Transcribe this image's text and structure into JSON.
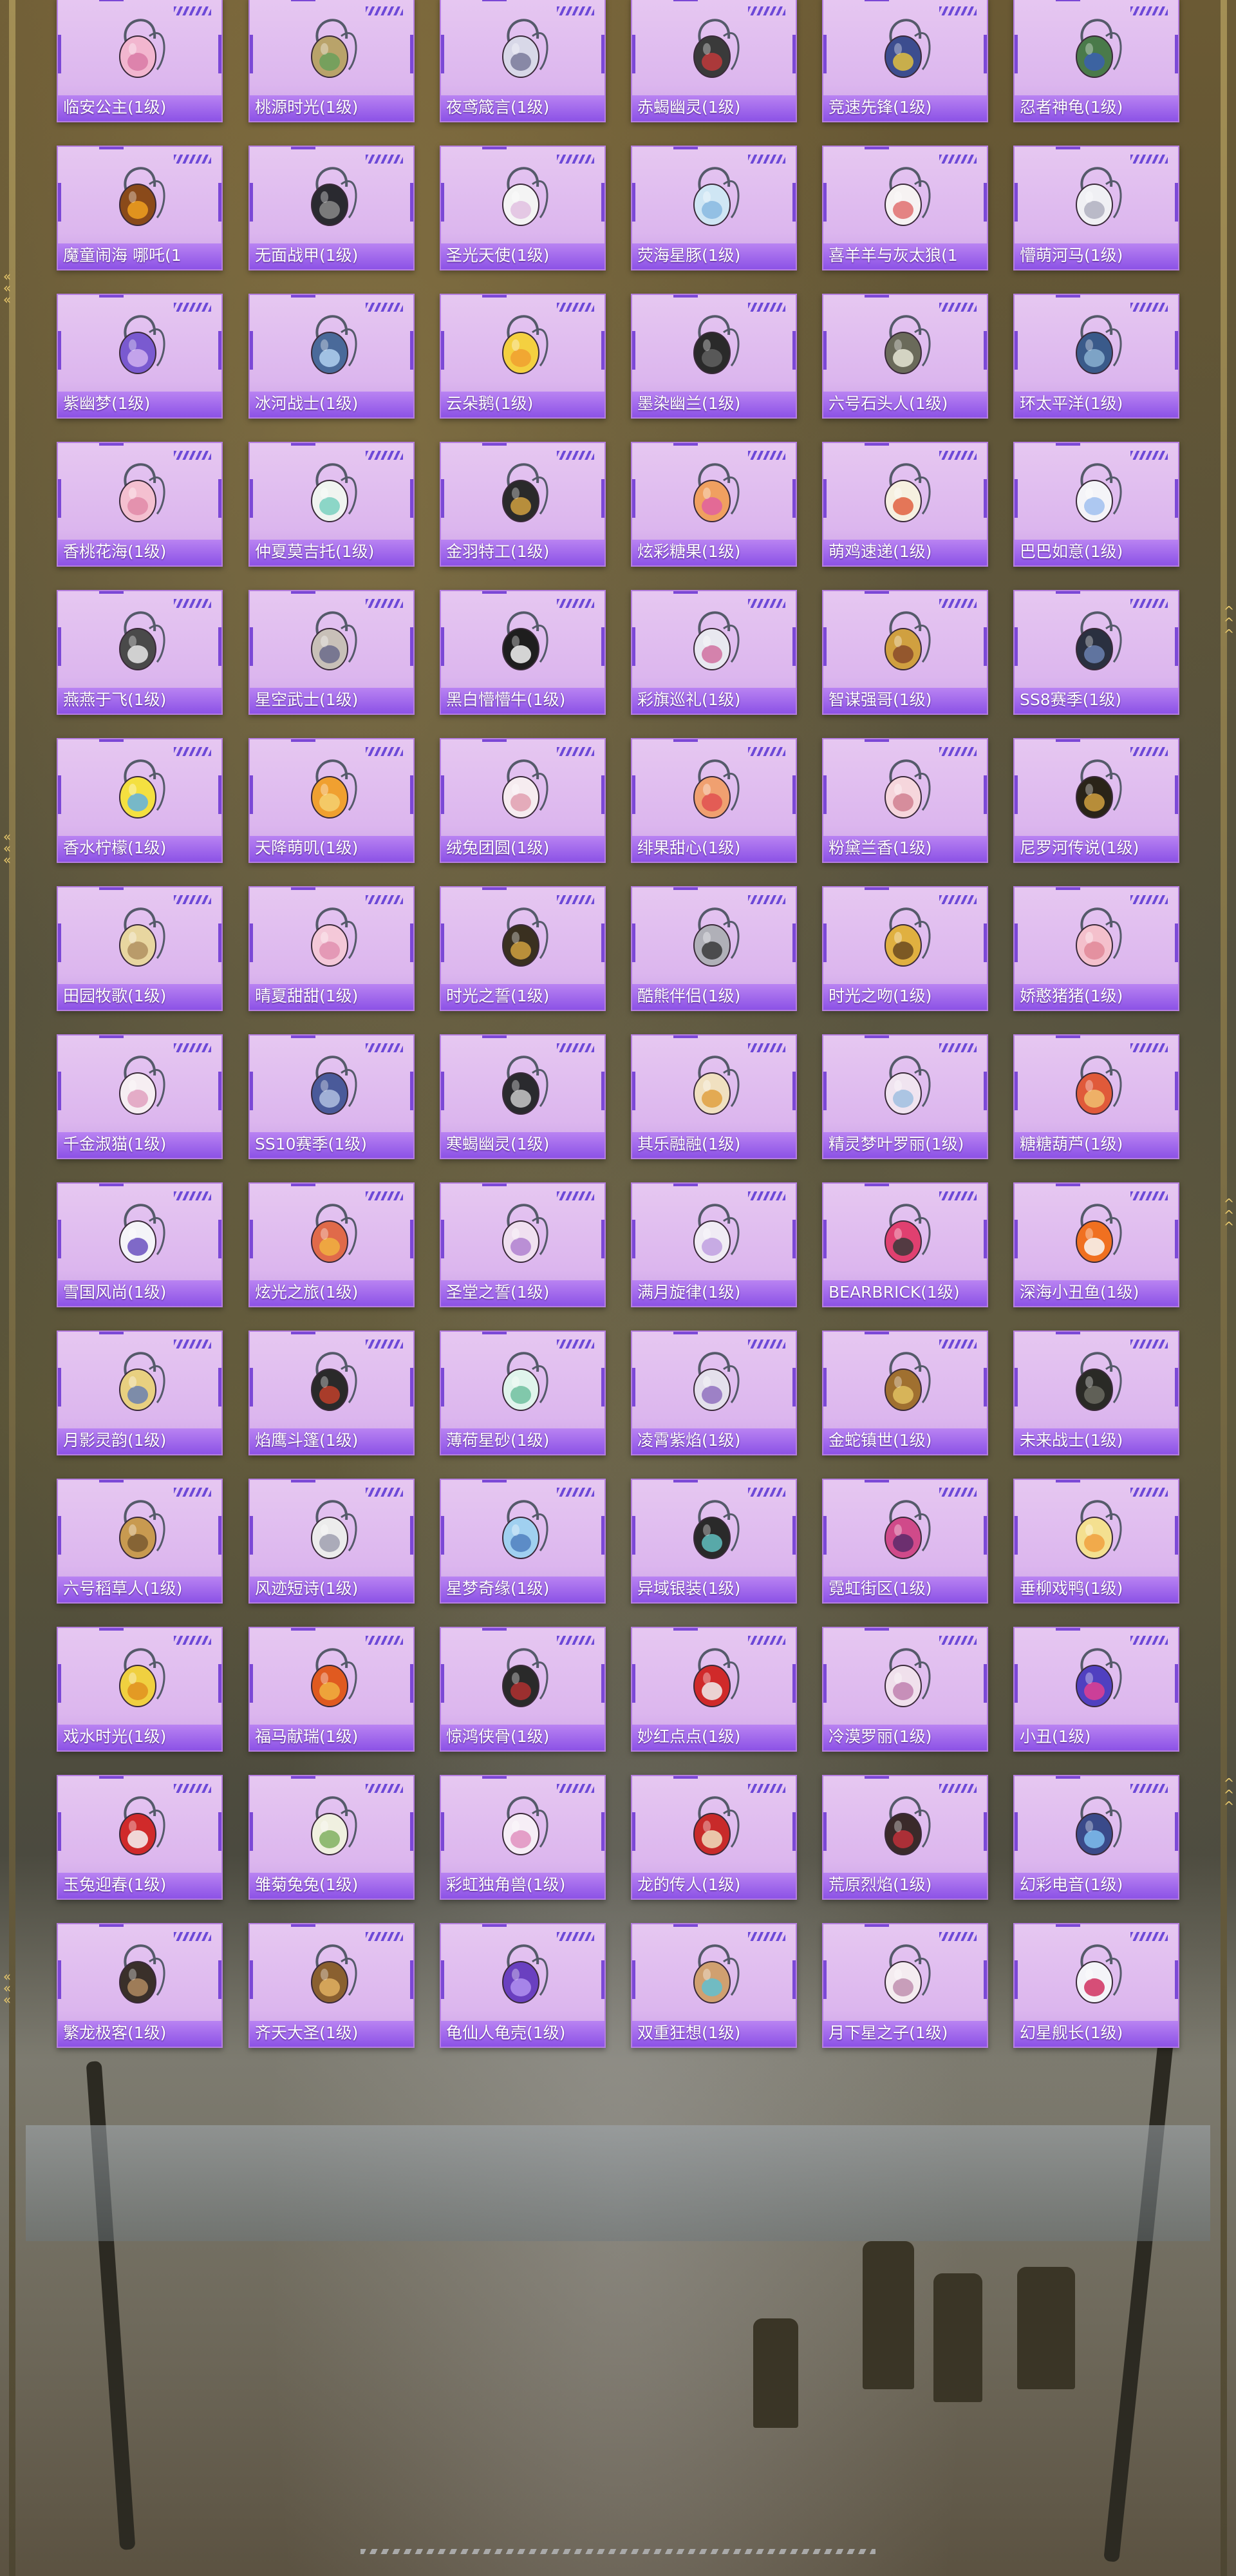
{
  "grid": {
    "level_suffix": "(1级)",
    "items": [
      {
        "name": "临安公主(1级)",
        "color": "#f2b6cf",
        "accent": "#d97aa6",
        "icon": "bag-pink-flower-icon"
      },
      {
        "name": "桃源时光(1级)",
        "color": "#b9a36a",
        "accent": "#6aa05a",
        "icon": "bag-basket-icon"
      },
      {
        "name": "夜鸢箴言(1级)",
        "color": "#d8d8e8",
        "accent": "#7a7a9a",
        "icon": "bag-doll-icon"
      },
      {
        "name": "赤蝎幽灵(1级)",
        "color": "#3a3a3a",
        "accent": "#c0393b",
        "icon": "bag-black-backpack-icon"
      },
      {
        "name": "竞速先锋(1级)",
        "color": "#3c4d8f",
        "accent": "#e0c040",
        "icon": "bag-racer-icon"
      },
      {
        "name": "忍者神龟(1级)",
        "color": "#4a7a4a",
        "accent": "#3a5fb0",
        "icon": "bag-turtle-icon"
      },
      {
        "name": "魔童闹海 哪吒(1",
        "color": "#8a4a1a",
        "accent": "#f0a020",
        "icon": "bag-round-medal-icon"
      },
      {
        "name": "无面战甲(1级)",
        "color": "#2a2a30",
        "accent": "#888888",
        "icon": "bag-armor-icon"
      },
      {
        "name": "圣光天使(1级)",
        "color": "#f4f4f4",
        "accent": "#e0c0e0",
        "icon": "bag-angel-icon"
      },
      {
        "name": "荧海星豚(1级)",
        "color": "#cfe6f4",
        "accent": "#88b8e0",
        "icon": "bag-dolphin-icon"
      },
      {
        "name": "喜羊羊与灰太狼(1",
        "color": "#f6f2f2",
        "accent": "#e07070",
        "icon": "bag-sheep-icon"
      },
      {
        "name": "懵萌河马(1级)",
        "color": "#f0f0f4",
        "accent": "#b0b0c0",
        "icon": "bag-hippo-icon"
      },
      {
        "name": "紫幽梦(1级)",
        "color": "#7a5ad0",
        "accent": "#d0b0f0",
        "icon": "bag-purple-orb-icon"
      },
      {
        "name": "冰河战士(1级)",
        "color": "#4a6a9a",
        "accent": "#b0d0f0",
        "icon": "bag-ice-warrior-icon"
      },
      {
        "name": "云朵鹅(1级)",
        "color": "#f4d040",
        "accent": "#f0a030",
        "icon": "bag-cloud-goose-icon"
      },
      {
        "name": "墨染幽兰(1级)",
        "color": "#2a2a2a",
        "accent": "#606060",
        "icon": "bag-ink-orchid-icon"
      },
      {
        "name": "六号石头人(1级)",
        "color": "#6a6a5a",
        "accent": "#e6e6d6",
        "icon": "bag-stone-man-icon"
      },
      {
        "name": "环太平洋(1级)",
        "color": "#3a5a8a",
        "accent": "#8ab0d0",
        "icon": "bag-mech-icon"
      },
      {
        "name": "香桃花海(1级)",
        "color": "#f4c0d0",
        "accent": "#e08aa8",
        "icon": "bag-peach-icon"
      },
      {
        "name": "仲夏莫吉托(1级)",
        "color": "#f0f4f0",
        "accent": "#7ad0c0",
        "icon": "bag-mojito-icon"
      },
      {
        "name": "金羽特工(1级)",
        "color": "#2a2a2a",
        "accent": "#d0a040",
        "icon": "bag-golden-agent-icon"
      },
      {
        "name": "炫彩糖果(1级)",
        "color": "#f0a060",
        "accent": "#e060a0",
        "icon": "bag-candy-icon"
      },
      {
        "name": "萌鸡速递(1级)",
        "color": "#f6f0e0",
        "accent": "#e06040",
        "icon": "bag-chick-icon"
      },
      {
        "name": "巴巴如意(1级)",
        "color": "#f4f4f8",
        "accent": "#a0c0f0",
        "icon": "bag-bunny-white-icon"
      },
      {
        "name": "燕燕于飞(1级)",
        "color": "#4a4a4a",
        "accent": "#e8e8e8",
        "icon": "bag-swallow-icon"
      },
      {
        "name": "星空武士(1级)",
        "color": "#c8c0b8",
        "accent": "#6a6a8a",
        "icon": "bag-star-warrior-icon"
      },
      {
        "name": "黑白懵懵牛(1级)",
        "color": "#1e1e1e",
        "accent": "#f4f4f4",
        "icon": "bag-cow-icon"
      },
      {
        "name": "彩旗巡礼(1级)",
        "color": "#e8e8f0",
        "accent": "#d070a0",
        "icon": "bag-flag-icon"
      },
      {
        "name": "智谋强哥(1级)",
        "color": "#d0a040",
        "accent": "#8a4a2a",
        "icon": "bag-bear-icon"
      },
      {
        "name": "SS8赛季(1级)",
        "color": "#2a3040",
        "accent": "#6a80b0",
        "icon": "bag-ss8-icon"
      },
      {
        "name": "香水柠檬(1级)",
        "color": "#f4e040",
        "accent": "#60b0e0",
        "icon": "bag-lemon-icon"
      },
      {
        "name": "天降萌叽(1级)",
        "color": "#f0a030",
        "accent": "#f4d070",
        "icon": "bag-bird-icon"
      },
      {
        "name": "绒兔团圆(1级)",
        "color": "#f6ecf0",
        "accent": "#e0a0b0",
        "icon": "bag-plush-bunny-icon"
      },
      {
        "name": "绯果甜心(1级)",
        "color": "#f0a070",
        "accent": "#e05050",
        "icon": "bag-fruit-icon"
      },
      {
        "name": "粉黛兰香(1级)",
        "color": "#f6d6dc",
        "accent": "#d08090",
        "icon": "bag-pink-orb-icon"
      },
      {
        "name": "尼罗河传说(1级)",
        "color": "#2a2418",
        "accent": "#d0a040",
        "icon": "bag-nile-icon"
      },
      {
        "name": "田园牧歌(1级)",
        "color": "#e8d6a0",
        "accent": "#b09060",
        "icon": "bag-wicker-icon"
      },
      {
        "name": "晴夏甜甜(1级)",
        "color": "#f4c8d8",
        "accent": "#e090b0",
        "icon": "bag-sweet-icon"
      },
      {
        "name": "时光之誓(1级)",
        "color": "#3a3020",
        "accent": "#d0a040",
        "icon": "bag-clock-icon"
      },
      {
        "name": "酷熊伴侣(1级)",
        "color": "#b0b0b8",
        "accent": "#3a3a3a",
        "icon": "bag-cool-bear-icon"
      },
      {
        "name": "时光之吻(1级)",
        "color": "#e0b040",
        "accent": "#6a4a20",
        "icon": "bag-kiss-icon"
      },
      {
        "name": "娇憨猪猪(1级)",
        "color": "#f4c0cc",
        "accent": "#e08898",
        "icon": "bag-pig-icon"
      },
      {
        "name": "千金淑猫(1级)",
        "color": "#f6eef2",
        "accent": "#e0a0c0",
        "icon": "bag-cat-icon"
      },
      {
        "name": "SS10赛季(1级)",
        "color": "#4a5a9a",
        "accent": "#b0c0e0",
        "icon": "bag-ss10-icon"
      },
      {
        "name": "寒蝎幽灵(1级)",
        "color": "#2a2a2e",
        "accent": "#c8c8c8",
        "icon": "bag-frost-scorpion-icon"
      },
      {
        "name": "其乐融融(1级)",
        "color": "#f0e0c0",
        "accent": "#e0a040",
        "icon": "bag-family-icon"
      },
      {
        "name": "精灵梦叶罗丽(1级)",
        "color": "#f0e4f0",
        "accent": "#a0c0e0",
        "icon": "bag-fairy-icon"
      },
      {
        "name": "糖糖葫芦(1级)",
        "color": "#e05a3a",
        "accent": "#f0c070",
        "icon": "bag-fox-icon"
      },
      {
        "name": "雪国风尚(1级)",
        "color": "#f4f4f8",
        "accent": "#6a50c0",
        "icon": "bag-snow-bunny-icon"
      },
      {
        "name": "炫光之旅(1级)",
        "color": "#e06a4a",
        "accent": "#f0b040",
        "icon": "bag-travel-icon"
      },
      {
        "name": "圣堂之誓(1级)",
        "color": "#f0e0f0",
        "accent": "#b080d0",
        "icon": "bag-heart-icon"
      },
      {
        "name": "满月旋律(1级)",
        "color": "#f0ecf4",
        "accent": "#c0a0e0",
        "icon": "bag-moon-icon"
      },
      {
        "name": "BEARBRICK(1级)",
        "color": "#e04070",
        "accent": "#3a3a3a",
        "icon": "bag-bearbrick-icon"
      },
      {
        "name": "深海小丑鱼(1级)",
        "color": "#f07020",
        "accent": "#f8f8f8",
        "icon": "bag-clownfish-icon"
      },
      {
        "name": "月影灵韵(1级)",
        "color": "#e8d080",
        "accent": "#6a80b0",
        "icon": "bag-moon-shadow-icon"
      },
      {
        "name": "焰鹰斗篷(1级)",
        "color": "#2a2a2a",
        "accent": "#c0402a",
        "icon": "bag-flame-eagle-icon"
      },
      {
        "name": "薄荷星砂(1级)",
        "color": "#e0f4ec",
        "accent": "#70c0a0",
        "icon": "bag-mint-icon"
      },
      {
        "name": "凌霄紫焰(1级)",
        "color": "#e4e0ec",
        "accent": "#9070c0",
        "icon": "bag-violet-flame-icon"
      },
      {
        "name": "金蛇镇世(1级)",
        "color": "#a07030",
        "accent": "#e0c060",
        "icon": "bag-golden-snake-icon"
      },
      {
        "name": "未来战士(1级)",
        "color": "#2a2a26",
        "accent": "#6a6a60",
        "icon": "bag-future-warrior-icon"
      },
      {
        "name": "六号稻草人(1级)",
        "color": "#c89a50",
        "accent": "#7a5a30",
        "icon": "bag-scarecrow-icon"
      },
      {
        "name": "风迹短诗(1级)",
        "color": "#ececec",
        "accent": "#a0a0b0",
        "icon": "bag-wind-poem-icon"
      },
      {
        "name": "星梦奇缘(1级)",
        "color": "#a0d0f0",
        "accent": "#5080c0",
        "icon": "bag-star-dream-icon"
      },
      {
        "name": "异域银装(1级)",
        "color": "#2a2a2a",
        "accent": "#60c0c0",
        "icon": "bag-exotic-icon"
      },
      {
        "name": "霓虹街区(1级)",
        "color": "#d04a8a",
        "accent": "#5a2a6a",
        "icon": "bag-neon-icon"
      },
      {
        "name": "垂柳戏鸭(1级)",
        "color": "#f4e090",
        "accent": "#f0a040",
        "icon": "bag-duck-icon"
      },
      {
        "name": "戏水时光(1级)",
        "color": "#f0d040",
        "accent": "#e09020",
        "icon": "bag-splash-icon"
      },
      {
        "name": "福马献瑞(1级)",
        "color": "#e05a20",
        "accent": "#f0b040",
        "icon": "bag-horse-icon"
      },
      {
        "name": "惊鸿侠骨(1级)",
        "color": "#2a2a2a",
        "accent": "#b03030",
        "icon": "bag-hero-icon"
      },
      {
        "name": "妙红点点(1级)",
        "color": "#d02a2a",
        "accent": "#f0f0f0",
        "icon": "bag-ladybug-icon"
      },
      {
        "name": "冷漠罗丽(1级)",
        "color": "#f0e0ec",
        "accent": "#c080b0",
        "icon": "bag-cold-doll-icon"
      },
      {
        "name": "小丑(1级)",
        "color": "#5040c0",
        "accent": "#e04090",
        "icon": "bag-clown-icon"
      },
      {
        "name": "玉兔迎春(1级)",
        "color": "#d02a2a",
        "accent": "#f6f6f6",
        "icon": "bag-jade-rabbit-icon"
      },
      {
        "name": "雏菊兔兔(1级)",
        "color": "#f0f0e0",
        "accent": "#80b060",
        "icon": "bag-daisy-bunny-icon"
      },
      {
        "name": "彩虹独角兽(1级)",
        "color": "#f6eef6",
        "accent": "#e090c0",
        "icon": "bag-unicorn-icon"
      },
      {
        "name": "龙的传人(1级)",
        "color": "#c82a2a",
        "accent": "#f0e0c0",
        "icon": "bag-dragon-heir-icon"
      },
      {
        "name": "荒原烈焰(1级)",
        "color": "#3a2a2a",
        "accent": "#c0303a",
        "icon": "bag-wasteland-flame-icon"
      },
      {
        "name": "幻彩电音(1级)",
        "color": "#3a4a8a",
        "accent": "#80c0f0",
        "icon": "bag-electro-icon"
      },
      {
        "name": "繁龙极客(1级)",
        "color": "#3a302a",
        "accent": "#b08a60",
        "icon": "bag-dragon-geek-icon"
      },
      {
        "name": "齐天大圣(1级)",
        "color": "#8a6030",
        "accent": "#e0b060",
        "icon": "bag-monkey-king-icon"
      },
      {
        "name": "龟仙人龟壳(1级)",
        "color": "#6a40c0",
        "accent": "#b090f0",
        "icon": "bag-turtle-shell-icon"
      },
      {
        "name": "双重狂想(1级)",
        "color": "#d0a070",
        "accent": "#60c0d0",
        "icon": "bag-double-fantasy-icon"
      },
      {
        "name": "月下星之子(1级)",
        "color": "#f4ecf0",
        "accent": "#c090b0",
        "icon": "bag-star-child-icon"
      },
      {
        "name": "幻星舰长(1级)",
        "color": "#f4f4f8",
        "accent": "#d03060",
        "icon": "bag-captain-icon"
      }
    ]
  },
  "colors": {
    "card_bg": "#e6c7f1",
    "card_border": "#b57ee0",
    "label_bar": "#8c52e6",
    "stripe_accent": "#6d49d8",
    "frame_gold": "#e9c96b"
  }
}
